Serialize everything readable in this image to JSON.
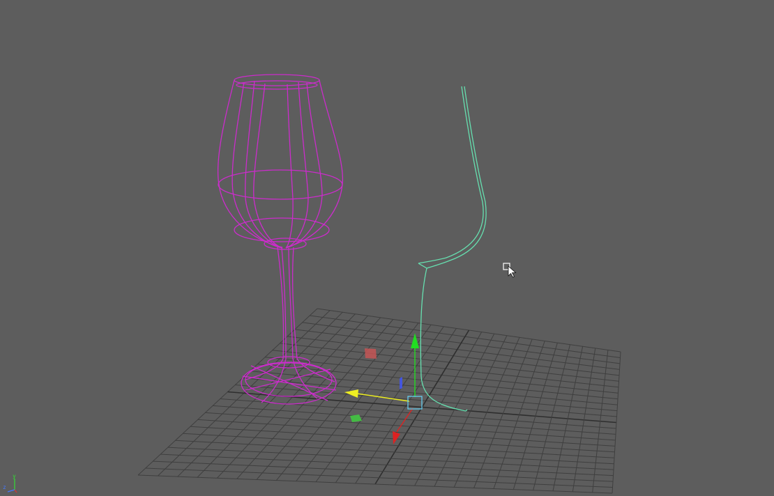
{
  "viewport": {
    "background": "#5d5d5d",
    "grid_color": "#3f3f3f",
    "grid_axis_color": "#2e2e2e"
  },
  "wine_glass": {
    "wire_color": "#cc2ccc"
  },
  "profile_curve": {
    "color": "#66e0b0"
  },
  "manipulator": {
    "y_color": "#22dd22",
    "x_color": "#eeee22",
    "z_color": "#dd2222",
    "center_color": "#66ccee",
    "plane_xy_color": "#cc5555",
    "plane_xz_color": "#44bb44",
    "plane_yz_color": "#4455dd"
  },
  "view_axis": {
    "z_label": "z",
    "y_label": "y",
    "z_color": "#4477ff",
    "y_color": "#33dd33",
    "x_color": "#dd3333"
  },
  "cursor": {
    "icon": "select-arrow-icon"
  }
}
